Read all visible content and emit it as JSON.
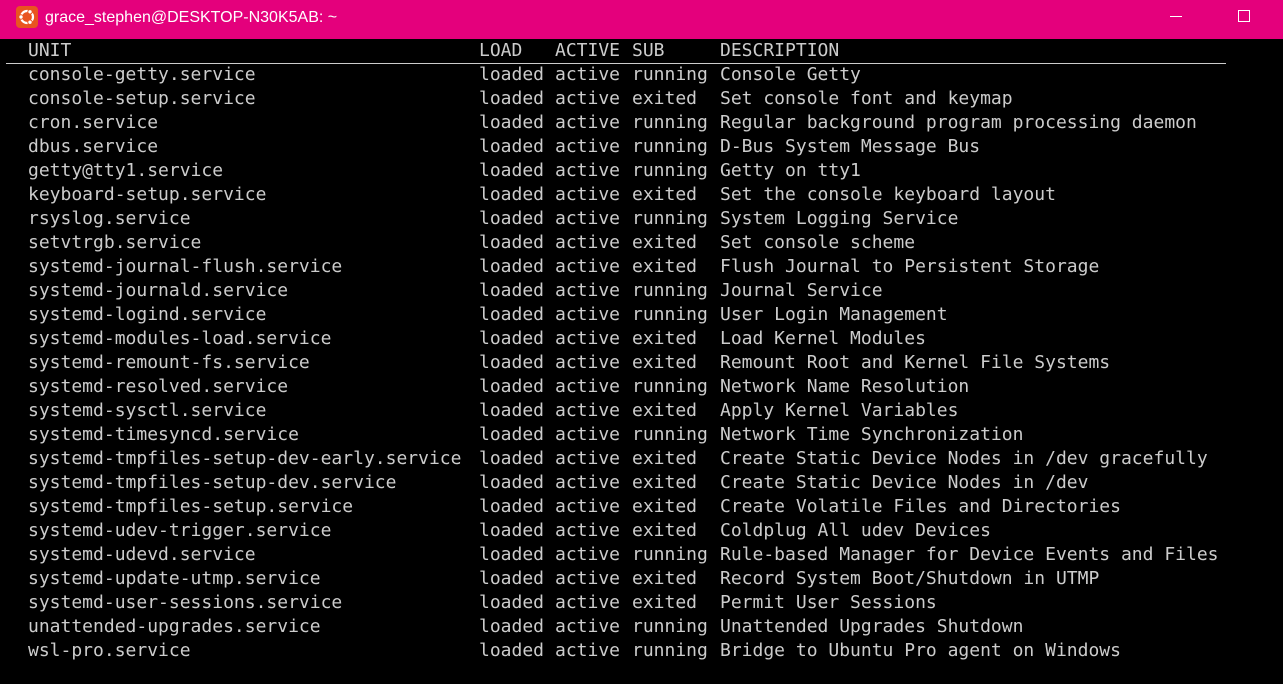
{
  "window": {
    "title": "grace_stephen@DESKTOP-N30K5AB: ~",
    "app_icon": "ubuntu-icon",
    "controls": [
      "minimize-icon",
      "maximize-icon"
    ],
    "colors": {
      "titlebar": "#e4007c",
      "terminal_bg": "#000000",
      "terminal_fg": "#cccccc"
    }
  },
  "table": {
    "headers": {
      "unit": "UNIT",
      "load": "LOAD",
      "active": "ACTIVE",
      "sub": "SUB",
      "description": "DESCRIPTION"
    },
    "rows": [
      {
        "unit": "console-getty.service",
        "load": "loaded",
        "active": "active",
        "sub": "running",
        "description": "Console Getty"
      },
      {
        "unit": "console-setup.service",
        "load": "loaded",
        "active": "active",
        "sub": "exited",
        "description": "Set console font and keymap"
      },
      {
        "unit": "cron.service",
        "load": "loaded",
        "active": "active",
        "sub": "running",
        "description": "Regular background program processing daemon"
      },
      {
        "unit": "dbus.service",
        "load": "loaded",
        "active": "active",
        "sub": "running",
        "description": "D-Bus System Message Bus"
      },
      {
        "unit": "getty@tty1.service",
        "load": "loaded",
        "active": "active",
        "sub": "running",
        "description": "Getty on tty1"
      },
      {
        "unit": "keyboard-setup.service",
        "load": "loaded",
        "active": "active",
        "sub": "exited",
        "description": "Set the console keyboard layout"
      },
      {
        "unit": "rsyslog.service",
        "load": "loaded",
        "active": "active",
        "sub": "running",
        "description": "System Logging Service"
      },
      {
        "unit": "setvtrgb.service",
        "load": "loaded",
        "active": "active",
        "sub": "exited",
        "description": "Set console scheme"
      },
      {
        "unit": "systemd-journal-flush.service",
        "load": "loaded",
        "active": "active",
        "sub": "exited",
        "description": "Flush Journal to Persistent Storage"
      },
      {
        "unit": "systemd-journald.service",
        "load": "loaded",
        "active": "active",
        "sub": "running",
        "description": "Journal Service"
      },
      {
        "unit": "systemd-logind.service",
        "load": "loaded",
        "active": "active",
        "sub": "running",
        "description": "User Login Management"
      },
      {
        "unit": "systemd-modules-load.service",
        "load": "loaded",
        "active": "active",
        "sub": "exited",
        "description": "Load Kernel Modules"
      },
      {
        "unit": "systemd-remount-fs.service",
        "load": "loaded",
        "active": "active",
        "sub": "exited",
        "description": "Remount Root and Kernel File Systems"
      },
      {
        "unit": "systemd-resolved.service",
        "load": "loaded",
        "active": "active",
        "sub": "running",
        "description": "Network Name Resolution"
      },
      {
        "unit": "systemd-sysctl.service",
        "load": "loaded",
        "active": "active",
        "sub": "exited",
        "description": "Apply Kernel Variables"
      },
      {
        "unit": "systemd-timesyncd.service",
        "load": "loaded",
        "active": "active",
        "sub": "running",
        "description": "Network Time Synchronization"
      },
      {
        "unit": "systemd-tmpfiles-setup-dev-early.service",
        "load": "loaded",
        "active": "active",
        "sub": "exited",
        "description": "Create Static Device Nodes in /dev gracefully"
      },
      {
        "unit": "systemd-tmpfiles-setup-dev.service",
        "load": "loaded",
        "active": "active",
        "sub": "exited",
        "description": "Create Static Device Nodes in /dev"
      },
      {
        "unit": "systemd-tmpfiles-setup.service",
        "load": "loaded",
        "active": "active",
        "sub": "exited",
        "description": "Create Volatile Files and Directories"
      },
      {
        "unit": "systemd-udev-trigger.service",
        "load": "loaded",
        "active": "active",
        "sub": "exited",
        "description": "Coldplug All udev Devices"
      },
      {
        "unit": "systemd-udevd.service",
        "load": "loaded",
        "active": "active",
        "sub": "running",
        "description": "Rule-based Manager for Device Events and Files"
      },
      {
        "unit": "systemd-update-utmp.service",
        "load": "loaded",
        "active": "active",
        "sub": "exited",
        "description": "Record System Boot/Shutdown in UTMP"
      },
      {
        "unit": "systemd-user-sessions.service",
        "load": "loaded",
        "active": "active",
        "sub": "exited",
        "description": "Permit User Sessions"
      },
      {
        "unit": "unattended-upgrades.service",
        "load": "loaded",
        "active": "active",
        "sub": "running",
        "description": "Unattended Upgrades Shutdown"
      },
      {
        "unit": "wsl-pro.service",
        "load": "loaded",
        "active": "active",
        "sub": "running",
        "description": "Bridge to Ubuntu Pro agent on Windows"
      }
    ]
  }
}
